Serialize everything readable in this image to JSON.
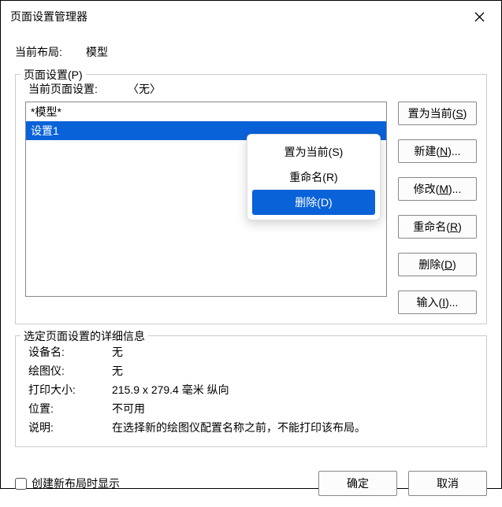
{
  "title": "页面设置管理器",
  "current_layout_label": "当前布局:",
  "current_layout_value": "模型",
  "page_setup": {
    "legend": "页面设置(P)",
    "current_label": "当前页面设置:",
    "current_value": "〈无〉",
    "items": [
      "*模型*",
      "设置1"
    ],
    "buttons": {
      "set_current": "置为当前(S)",
      "new": "新建(N)...",
      "modify": "修改(M)...",
      "rename": "重命名(R)",
      "delete": "删除(D)",
      "import": "输入(I)..."
    }
  },
  "context_menu": {
    "set_current": "置为当前(S)",
    "rename": "重命名(R)",
    "delete": "删除(D)"
  },
  "details": {
    "legend": "选定页面设置的详细信息",
    "device_label": "设备名:",
    "device_value": "无",
    "plotter_label": "绘图仪:",
    "plotter_value": "无",
    "size_label": "打印大小:",
    "size_value": "215.9 x 279.4 毫米  纵向",
    "location_label": "位置:",
    "location_value": "不可用",
    "desc_label": "说明:",
    "desc_value": "在选择新的绘图仪配置名称之前，不能打印该布局。"
  },
  "footer": {
    "checkbox_label": "创建新布局时显示",
    "ok": "确定",
    "cancel": "取消"
  }
}
